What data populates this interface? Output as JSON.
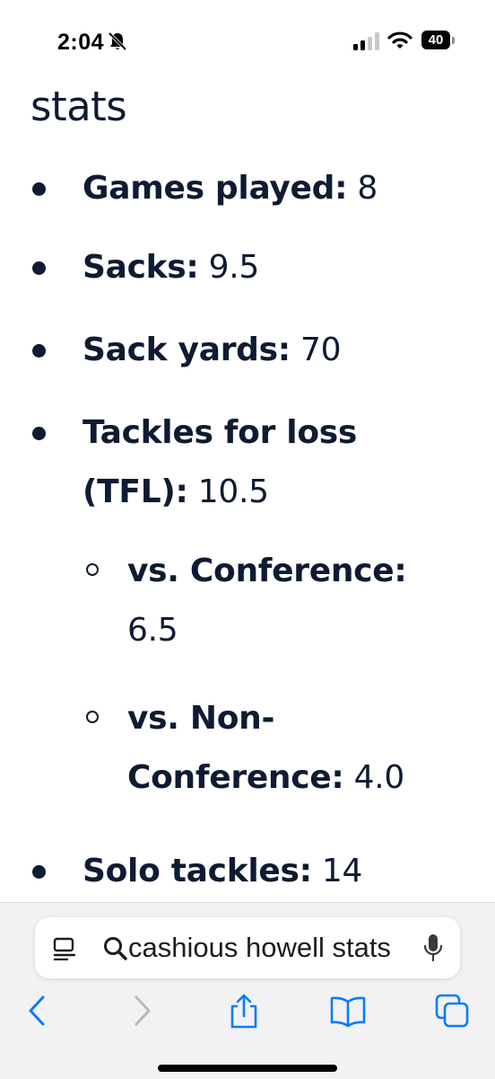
{
  "status_bar": {
    "time": "2:04",
    "battery_level": "40",
    "icons": [
      "bell-slash-icon",
      "cellular-signal-icon",
      "wifi-icon",
      "battery-icon"
    ]
  },
  "page": {
    "heading": "stats",
    "items": [
      {
        "label": "Games played:",
        "value": " 8"
      },
      {
        "label": "Sacks:",
        "value": " 9.5"
      },
      {
        "label": "Sack yards:",
        "value": " 70"
      },
      {
        "label_line1": "Tackles for loss",
        "label_line2": "(TFL):",
        "value": " 10.5"
      },
      {
        "label": "vs. Conference:",
        "value": "6.5"
      },
      {
        "label_line1": "vs. Non-",
        "label_line2": "Conference:",
        "value": " 4.0"
      },
      {
        "label": "Solo tackles:",
        "value": " 14"
      }
    ]
  },
  "browser": {
    "address_text": "cashious howell stats",
    "toolbar": [
      "back-icon",
      "forward-icon",
      "share-icon",
      "bookmarks-icon",
      "tabs-icon"
    ]
  },
  "colors": {
    "text": "#0e1b32",
    "accent": "#0a7aff",
    "toolbar_bg": "#f2f2f4",
    "disabled": "#b8b8bd"
  }
}
